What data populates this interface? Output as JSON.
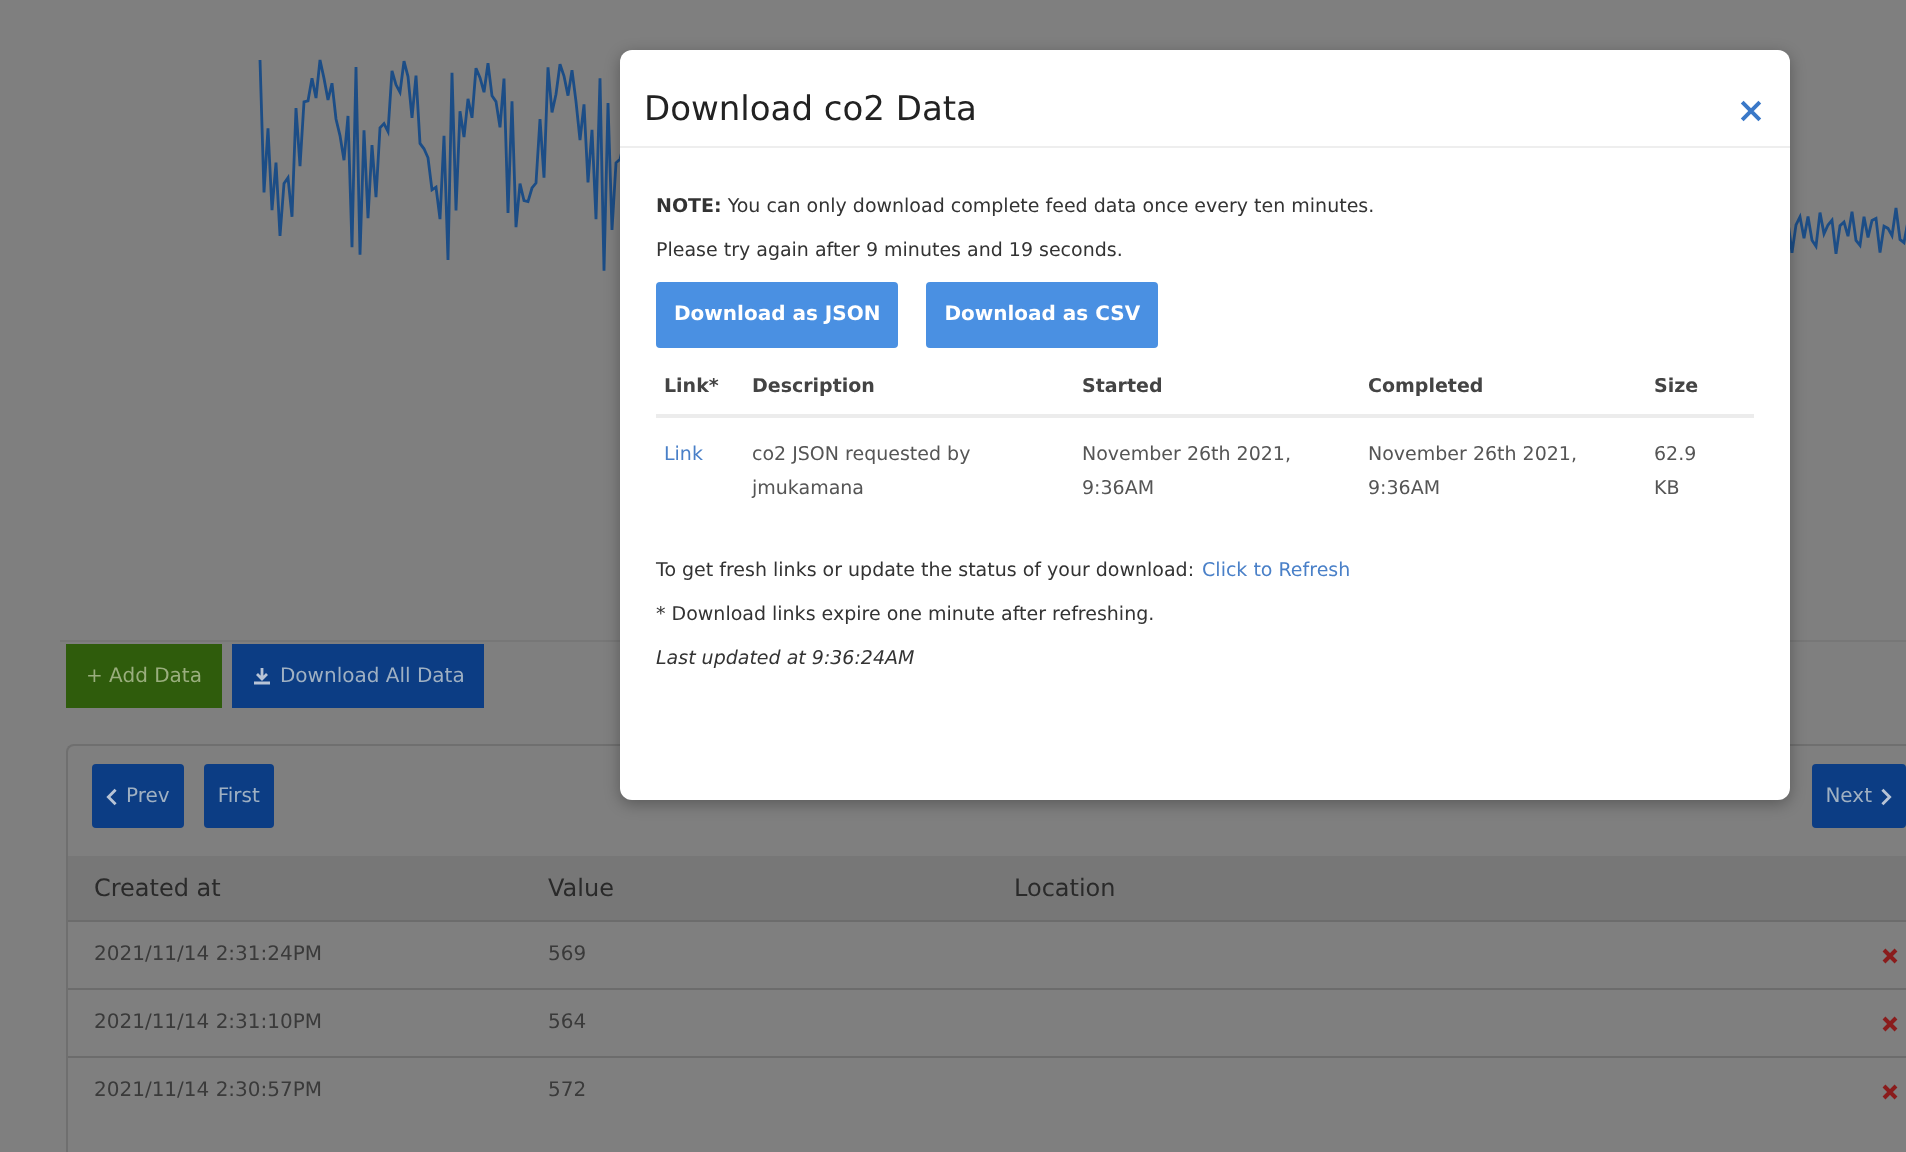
{
  "toolbar": [
    {
      "kind": "add",
      "label": "+ Add Data"
    },
    {
      "kind": "download",
      "label": "Download All Data"
    }
  ],
  "pager": {
    "prev": "Prev",
    "first": "First",
    "next": "Next"
  },
  "table": {
    "columns": [
      "Created at",
      "Value",
      "Location"
    ],
    "rows": [
      {
        "created_at": "2021/11/14 2:31:24PM",
        "value": "569"
      },
      {
        "created_at": "2021/11/14 2:31:10PM",
        "value": "564"
      },
      {
        "created_at": "2021/11/14 2:30:57PM",
        "value": "572"
      }
    ]
  },
  "modal": {
    "title": "Download co2 Data",
    "note": "**NOTE:** You can only download complete feed data once every ten minutes.",
    "retry": "Please try again after 9 minutes and 19 seconds.",
    "buttons": [
      "Download as JSON",
      "Download as CSV"
    ],
    "columns": [
      "Link*",
      "Description",
      "Started",
      "Completed",
      "Size"
    ],
    "rows": [
      {
        "link": "Link",
        "description": "co2 JSON requested by jmukamana",
        "started": "November 26th 2021, 9:36AM",
        "completed": "November 26th 2021, 9:36AM",
        "size": "62.9 KB"
      }
    ],
    "refresh_text": "To get fresh links or update the status of your download:",
    "refresh_link": "Click to Refresh",
    "footnote": "* Download links expire one minute after refreshing.",
    "last_updated": "Last updated at 9:36:24AM"
  }
}
